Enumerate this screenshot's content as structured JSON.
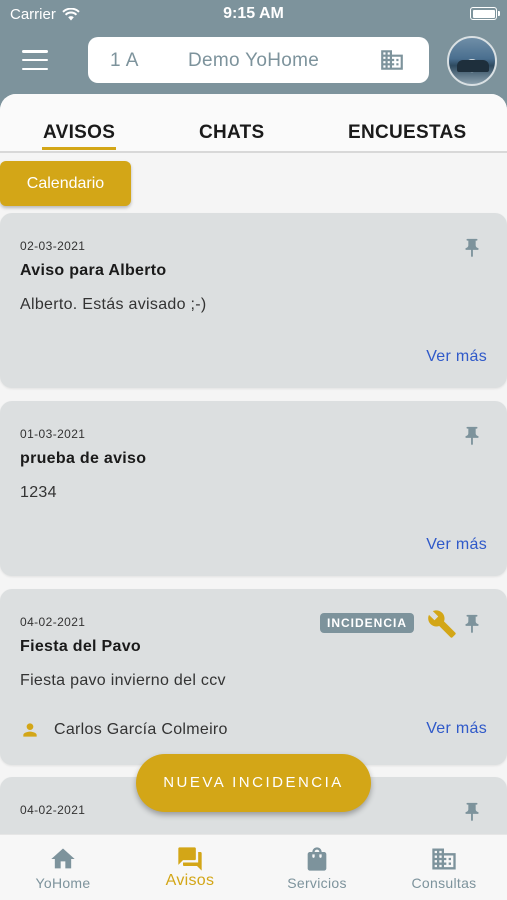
{
  "status_bar": {
    "carrier": "Carrier",
    "time": "9:15 AM",
    "icons": [
      "wifi-icon",
      "battery-icon"
    ]
  },
  "header": {
    "unit": "1 A",
    "community": "Demo YoHome",
    "icons": [
      "menu-icon",
      "building-icon",
      "avatar"
    ]
  },
  "tabs": [
    {
      "label": "AVISOS",
      "active": true
    },
    {
      "label": "CHATS",
      "active": false
    },
    {
      "label": "ENCUESTAS",
      "active": false
    }
  ],
  "calendar_button": "Calendario",
  "notices": [
    {
      "date": "02-03-2021",
      "title": "Aviso para Alberto",
      "body": "Alberto. Estás avisado ;-)",
      "more": "Ver más",
      "icons": [
        "pin-icon"
      ]
    },
    {
      "date": "01-03-2021",
      "title": "prueba de aviso",
      "body": "1234",
      "more": "Ver más",
      "icons": [
        "pin-icon"
      ]
    },
    {
      "date": "04-02-2021",
      "title": "Fiesta del Pavo",
      "body": "Fiesta pavo invierno del ccv",
      "badge": "INCIDENCIA",
      "author": "Carlos García Colmeiro",
      "more": "Ver más",
      "icons": [
        "wrench-icon",
        "pin-icon",
        "person-icon"
      ]
    },
    {
      "date": "04-02-2021",
      "icons": [
        "pin-icon"
      ]
    }
  ],
  "fab": "NUEVA INCIDENCIA",
  "bottom_nav": [
    {
      "label": "YoHome",
      "icon": "home-icon",
      "active": false
    },
    {
      "label": "Avisos",
      "icon": "forum-icon",
      "active": true
    },
    {
      "label": "Servicios",
      "icon": "shopping-bag-icon",
      "active": false
    },
    {
      "label": "Consultas",
      "icon": "building-icon",
      "active": false
    }
  ],
  "colors": {
    "primary": "#7d939c",
    "accent": "#d3a617",
    "card": "#dcdfe0",
    "link": "#2f59c9"
  }
}
